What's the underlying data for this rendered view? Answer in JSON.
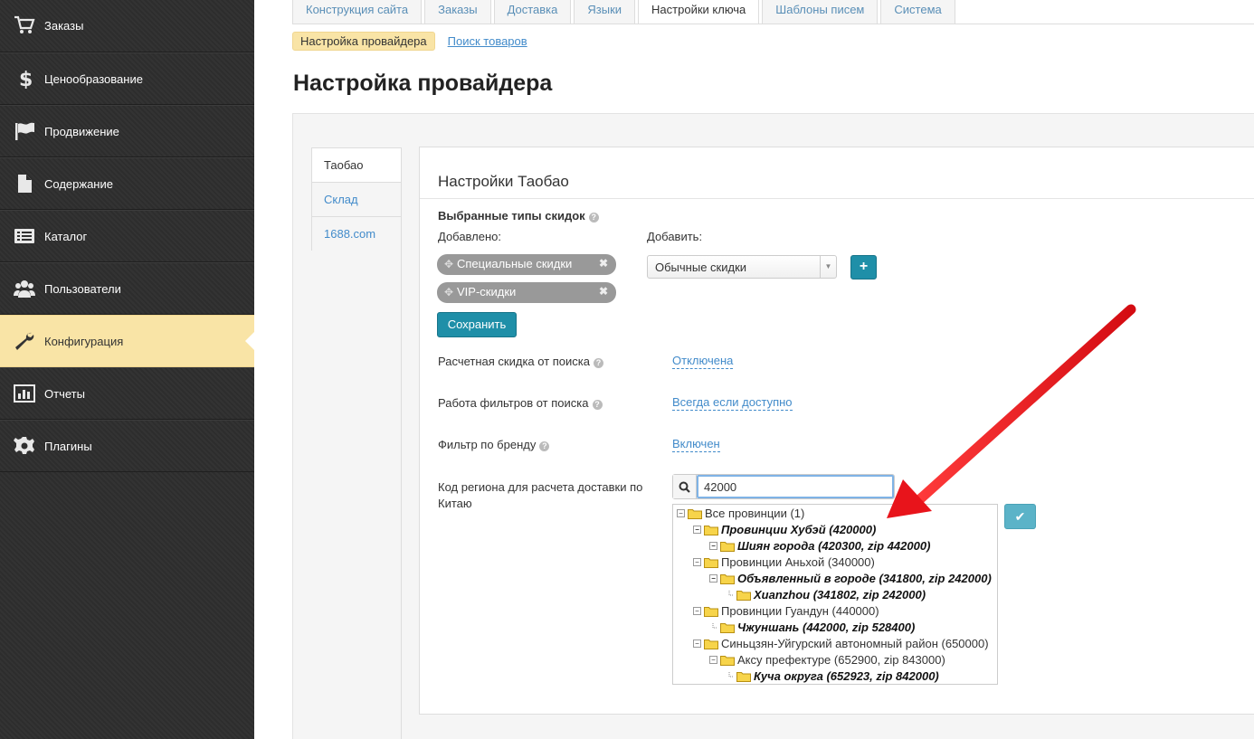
{
  "sidebar": {
    "items": [
      {
        "label": "Заказы",
        "icon": "cart-icon"
      },
      {
        "label": "Ценообразование",
        "icon": "dollar-icon"
      },
      {
        "label": "Продвижение",
        "icon": "flag-icon"
      },
      {
        "label": "Содержание",
        "icon": "file-icon"
      },
      {
        "label": "Каталог",
        "icon": "list-icon"
      },
      {
        "label": "Пользователи",
        "icon": "users-icon"
      },
      {
        "label": "Конфигурация",
        "icon": "wrench-icon",
        "active": true
      },
      {
        "label": "Отчеты",
        "icon": "chart-icon"
      },
      {
        "label": "Плагины",
        "icon": "gear-icon"
      }
    ]
  },
  "top_tabs": [
    "Конструкция сайта",
    "Заказы",
    "Доставка",
    "Языки",
    "Настройки ключа",
    "Шаблоны писем",
    "Система"
  ],
  "subnav": {
    "active": "Настройка провайдера",
    "link": "Поиск товаров"
  },
  "page_title": "Настройка провайдера",
  "vtabs": [
    "Таобао",
    "Склад",
    "1688.com"
  ],
  "panel": {
    "title": "Настройки Таобао",
    "discounts_label": "Выбранные типы скидок",
    "added_label": "Добавлено:",
    "add_label": "Добавить:",
    "chips": [
      "Специальные скидки",
      "VIP-скидки"
    ],
    "select_value": "Обычные скидки",
    "add_button": "+",
    "save_button": "Сохранить",
    "settings": [
      {
        "label": "Расчетная скидка от поиска",
        "value": "Отключена"
      },
      {
        "label": "Работа фильтров от поиска",
        "value": "Всегда если доступно"
      },
      {
        "label": "Фильтр по бренду",
        "value": "Включен"
      }
    ],
    "region_label": "Код региона для расчета доставки по Китаю",
    "region_value": "42000",
    "ok_button": "✔"
  },
  "tree": [
    {
      "text": "Все провинции (1)",
      "bold": false
    },
    {
      "text": "Провинции Хубэй (420000)",
      "bold": true
    },
    {
      "text": "Шиян города (420300, zip 442000)",
      "bold": true
    },
    {
      "text": "Провинции Аньхой (340000)",
      "bold": false
    },
    {
      "text": "Объявленный в городе (341800, zip 242000)",
      "bold": true
    },
    {
      "text": "Xuanzhou (341802, zip 242000)",
      "bold": true
    },
    {
      "text": "Провинции Гуандун (440000)",
      "bold": false
    },
    {
      "text": "Чжуншань (442000, zip 528400)",
      "bold": true
    },
    {
      "text": "Синьцзян-Уйгурский автономный район (650000)",
      "bold": false
    },
    {
      "text": "Аксу префектуре (652900, zip 843000)",
      "bold": false
    },
    {
      "text": "Куча округа (652923, zip 842000)",
      "bold": true
    }
  ],
  "colors": {
    "accent": "#1f8fa8",
    "active_menu": "#f9e4a6",
    "arrow": "#e8141b",
    "link": "#428bca"
  }
}
